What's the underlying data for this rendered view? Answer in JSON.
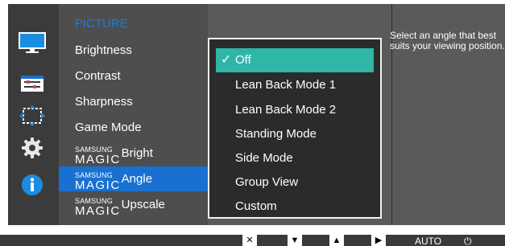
{
  "menu": {
    "title": "PICTURE",
    "items": [
      {
        "label": "Brightness"
      },
      {
        "label": "Contrast"
      },
      {
        "label": "Sharpness"
      },
      {
        "label": "Game Mode"
      },
      {
        "brand": "SAMSUNG",
        "magic": "MAGIC",
        "label": "Bright"
      },
      {
        "brand": "SAMSUNG",
        "magic": "MAGIC",
        "label": "Angle",
        "selected": true
      },
      {
        "brand": "SAMSUNG",
        "magic": "MAGIC",
        "label": "Upscale"
      }
    ]
  },
  "dropdown": {
    "checkmark": "✓",
    "options": [
      {
        "label": "Off",
        "selected": true
      },
      {
        "label": "Lean Back Mode 1"
      },
      {
        "label": "Lean Back Mode 2"
      },
      {
        "label": "Standing Mode"
      },
      {
        "label": "Side Mode"
      },
      {
        "label": "Group View"
      },
      {
        "label": "Custom"
      }
    ]
  },
  "help": {
    "text": "Select an angle that best suits your viewing position."
  },
  "icons": {
    "rail": [
      "picture-icon",
      "onscreen-display-icon",
      "size-position-icon",
      "setup-gear-icon",
      "information-icon"
    ]
  },
  "buttons": {
    "close": "✕",
    "down": "▼",
    "up": "▲",
    "enter": "▶",
    "auto": "AUTO",
    "power": "⏻"
  },
  "colors": {
    "accent_blue": "#1a70d0",
    "title_blue": "#1a7dd9",
    "option_teal": "#2fb6a6",
    "panel_gray": "#4e4e4e",
    "rail_gray": "#3b3b3b"
  }
}
